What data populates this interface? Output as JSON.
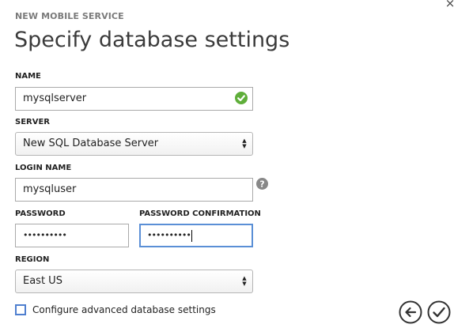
{
  "dialog": {
    "close_glyph": "×",
    "subtitle": "NEW MOBILE SERVICE",
    "title": "Specify database settings"
  },
  "form": {
    "name": {
      "label": "NAME",
      "value": "mysqlserver",
      "status_icon": "check-circle-icon"
    },
    "server": {
      "label": "SERVER",
      "selected": "New SQL Database Server"
    },
    "login_name": {
      "label": "LOGIN NAME",
      "value": "mysqluser",
      "help_icon": "question-circle-icon"
    },
    "password": {
      "label": "PASSWORD",
      "masked_value": "••••••••••"
    },
    "password_confirmation": {
      "label": "PASSWORD CONFIRMATION",
      "masked_value": "••••••••••"
    },
    "region": {
      "label": "REGION",
      "selected": "East US"
    },
    "advanced": {
      "label": "Configure advanced database settings",
      "checked": false
    }
  },
  "footer": {
    "back_icon": "arrow-left-circle-icon",
    "confirm_icon": "checkmark-circle-icon"
  },
  "colors": {
    "valid_green": "#5fae3a",
    "focus_blue": "#5a8fd6",
    "checkbox_blue": "#4f7fcf",
    "help_gray": "#888888"
  }
}
